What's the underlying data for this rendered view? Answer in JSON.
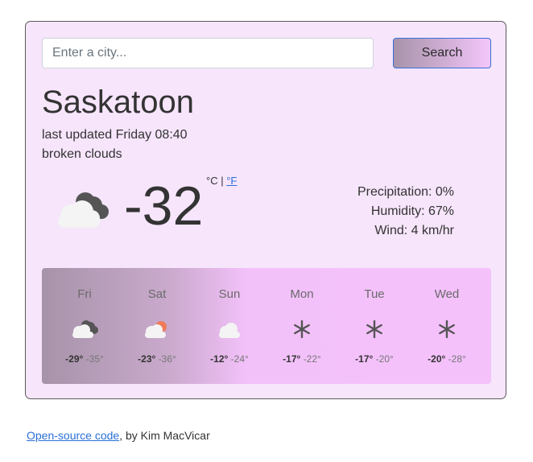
{
  "search": {
    "placeholder": "Enter a city...",
    "button_label": "Search"
  },
  "current": {
    "city": "Saskatoon",
    "updated": "last updated Friday 08:40",
    "description": "broken clouds",
    "temperature": "-32",
    "unit_celsius": "°C",
    "unit_separator": " | ",
    "unit_fahrenheit": "°F",
    "icon": "broken-clouds-icon",
    "precipitation": "Precipitation: 0%",
    "humidity": "Humidity: 67%",
    "wind": "Wind: 4 km/hr"
  },
  "forecast": [
    {
      "day": "Fri",
      "icon": "broken-clouds-icon",
      "max": "-29°",
      "min": "-35°"
    },
    {
      "day": "Sat",
      "icon": "sun-behind-cloud-icon",
      "max": "-23°",
      "min": "-36°"
    },
    {
      "day": "Sun",
      "icon": "cloud-icon",
      "max": "-12°",
      "min": "-24°"
    },
    {
      "day": "Mon",
      "icon": "snowflake-icon",
      "max": "-17°",
      "min": "-22°"
    },
    {
      "day": "Tue",
      "icon": "snowflake-icon",
      "max": "-17°",
      "min": "-20°"
    },
    {
      "day": "Wed",
      "icon": "snowflake-icon",
      "max": "-20°",
      "min": "-28°"
    }
  ],
  "footer": {
    "link_text": "Open-source code",
    "credit": ", by Kim MacVicar"
  },
  "colors": {
    "card_bg": "#f6e5fb",
    "accent_link": "#2a6fd8",
    "gradient_start": "#a793a9",
    "gradient_end": "#f4c1fb"
  }
}
